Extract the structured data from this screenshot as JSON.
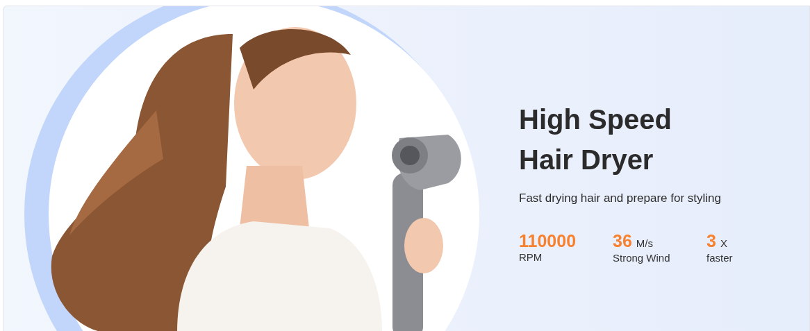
{
  "banner": {
    "title": "High Speed Hair Dryer",
    "subtitle": "Fast drying hair and prepare for styling",
    "stats": [
      {
        "value": "110000",
        "label": "RPM"
      },
      {
        "value": "36",
        "unit": "M/s",
        "label": "Strong Wind"
      },
      {
        "value": "3",
        "unit": "X",
        "label": "faster"
      }
    ]
  }
}
